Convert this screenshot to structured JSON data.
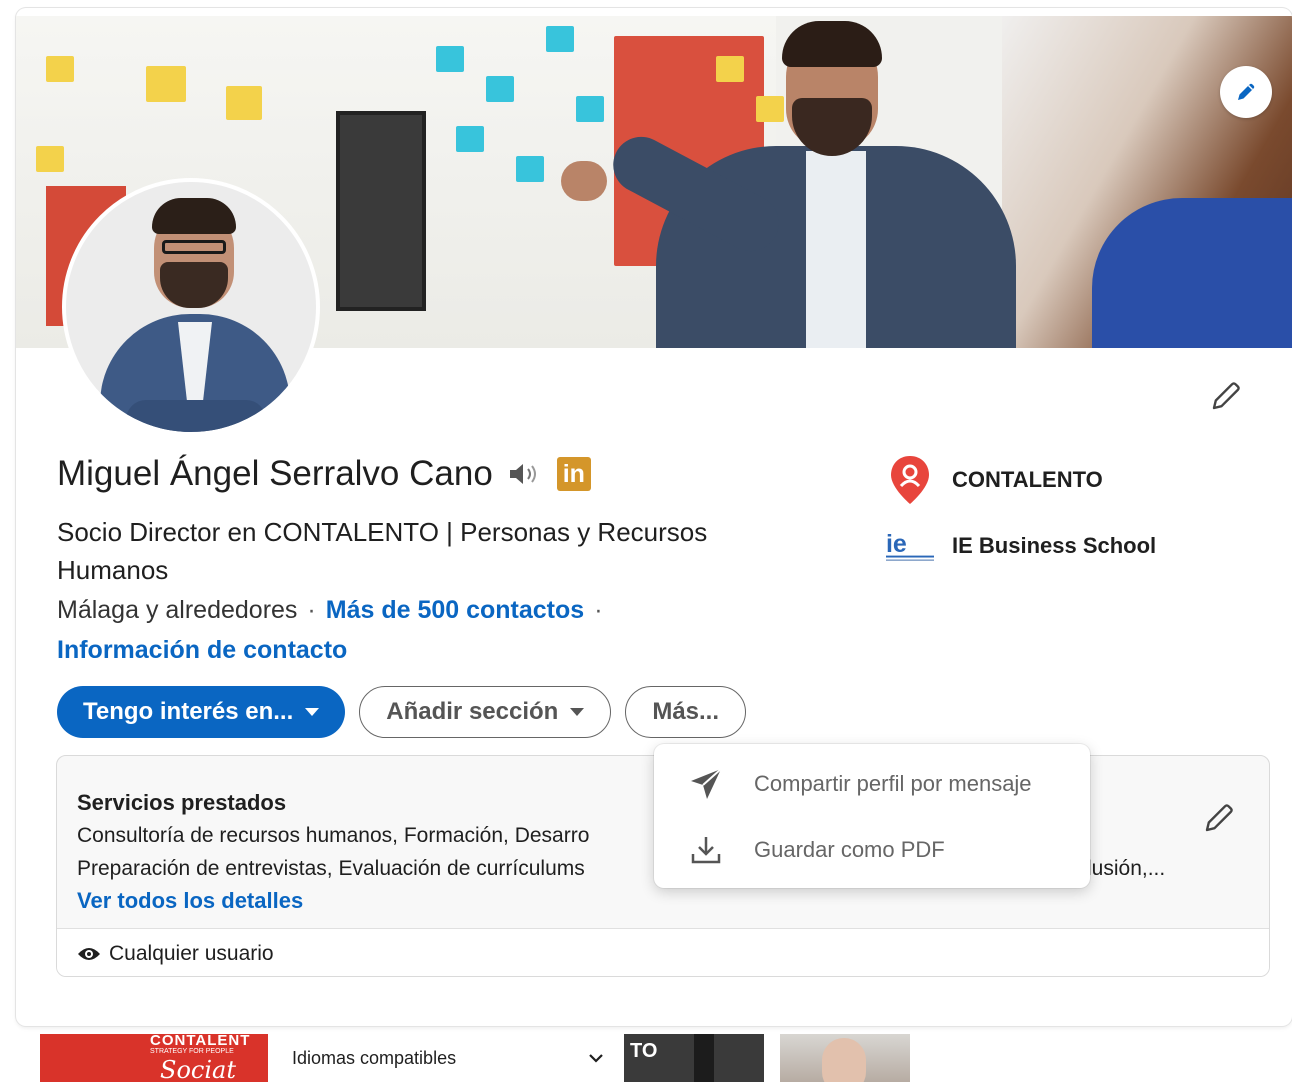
{
  "profile": {
    "name": "Miguel Ángel Serralvo Cano",
    "headline": "Socio Director en CONTALENTO | Personas y Recursos Humanos",
    "location": "Málaga y alrededores",
    "separator": "·",
    "contacts": "Más de 500 contactos",
    "contact_info": "Información de contacto",
    "linkedin_badge": "in"
  },
  "organizations": [
    {
      "name": "CONTALENTO",
      "icon": "map-pin-icon"
    },
    {
      "name": "IE Business School",
      "icon": "ie-logo"
    }
  ],
  "actions": {
    "primary": "Tengo interés en...",
    "add_section": "Añadir sección",
    "more": "Más..."
  },
  "more_menu": {
    "items": [
      {
        "label": "Compartir perfil por mensaje",
        "icon": "send-icon"
      },
      {
        "label": "Guardar como PDF",
        "icon": "download-icon"
      }
    ]
  },
  "services": {
    "title": "Servicios prestados",
    "line1": "Consultoría de recursos humanos, Formación, Desarro",
    "line2": "Preparación de entrevistas, Evaluación de currículums",
    "line2_tail": "lusión,...",
    "details_link": "Ver todos los detalles",
    "visibility": "Cualquier usuario"
  },
  "bottom": {
    "language_select": "Idiomas compatibles",
    "thumb1_title": "CONTALENT",
    "thumb1_sub": "STRATEGY FOR PEOPLE",
    "thumb1_script": "Sociat",
    "thumb2_text": "TO"
  },
  "colors": {
    "accent": "#0a66c2",
    "linkedin_badge": "#d4962a",
    "pin_red": "#e8453c",
    "ie_blue": "#2a67b8"
  }
}
